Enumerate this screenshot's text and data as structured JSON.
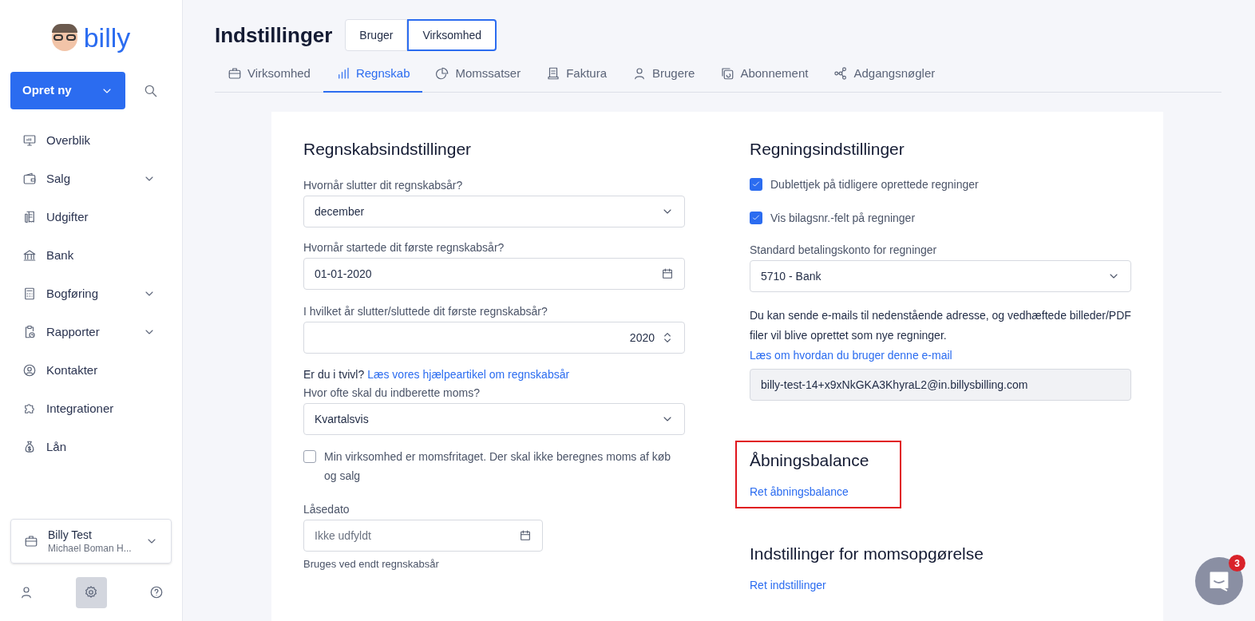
{
  "sidebar": {
    "logo_text": "billy",
    "create_button": "Opret ny",
    "items": [
      {
        "label": "Overblik",
        "expandable": false
      },
      {
        "label": "Salg",
        "expandable": true
      },
      {
        "label": "Udgifter",
        "expandable": false
      },
      {
        "label": "Bank",
        "expandable": false
      },
      {
        "label": "Bogføring",
        "expandable": true
      },
      {
        "label": "Rapporter",
        "expandable": true
      },
      {
        "label": "Kontakter",
        "expandable": false
      },
      {
        "label": "Integrationer",
        "expandable": false
      },
      {
        "label": "Lån",
        "expandable": false
      }
    ],
    "account": {
      "name": "Billy Test",
      "owner": "Michael Boman H..."
    },
    "bottom_icons": [
      {
        "selected": false
      },
      {
        "selected": true
      },
      {
        "selected": false
      }
    ]
  },
  "header": {
    "title": "Indstillinger",
    "scope_tabs": [
      {
        "label": "Bruger",
        "selected": false
      },
      {
        "label": "Virksomhed",
        "selected": true
      }
    ]
  },
  "tabs": [
    {
      "label": "Virksomhed",
      "selected": false
    },
    {
      "label": "Regnskab",
      "selected": true
    },
    {
      "label": "Momssatser",
      "selected": false
    },
    {
      "label": "Faktura",
      "selected": false
    },
    {
      "label": "Brugere",
      "selected": false
    },
    {
      "label": "Abonnement",
      "selected": false
    },
    {
      "label": "Adgangsnøgler",
      "selected": false
    }
  ],
  "left": {
    "heading": "Regnskabsindstillinger",
    "rows": [
      {
        "kind": "select",
        "label": "Hvornår slutter dit regnskabsår?",
        "value": "december"
      },
      {
        "kind": "date",
        "label": "Hvornår startede dit første regnskabsår?",
        "value": "01-01-2020"
      },
      {
        "kind": "number",
        "label": "I hvilket år slutter/sluttede dit første regnskabsår?",
        "value": "2020"
      },
      {
        "kind": "help",
        "text": "Er du i tvivl?",
        "link": "Læs vores hjælpeartikel om regnskabsår"
      },
      {
        "kind": "select",
        "label": "Hvor ofte skal du indberette moms?",
        "value": "Kvartalsvis"
      },
      {
        "kind": "checkbox",
        "label": "Min virksomhed er momsfritaget. Der skal ikke beregnes moms af køb og salg",
        "checked": false
      },
      {
        "kind": "date_short",
        "label": "Låsedato",
        "placeholder": "Ikke udfyldt",
        "hint": "Bruges ved endt regnskabsår"
      }
    ]
  },
  "right": {
    "heading": "Regningsindstillinger",
    "rows": [
      {
        "kind": "checkbox",
        "label": "Dublettjek på tidligere oprettede regninger",
        "checked": true
      },
      {
        "kind": "checkbox",
        "label": "Vis bilagsnr.-felt på regninger",
        "checked": true
      },
      {
        "kind": "select",
        "label": "Standard betalingskonto for regninger",
        "value": "5710 - Bank"
      },
      {
        "kind": "paragraph",
        "text": "Du kan sende e-mails til nedenstående adresse, og vedhæftede billeder/PDF filer vil blive oprettet som nye regninger.",
        "link": "Læs om hvordan du bruger denne e-mail"
      },
      {
        "kind": "readonly",
        "value": "billy-test-14+x9xNkGKA3KhyraL2@in.billysbilling.com"
      }
    ],
    "sections": [
      {
        "heading": "Åbningsbalance",
        "link": "Ret åbningsbalance",
        "highlighted": true
      },
      {
        "heading": "Indstillinger for momsopgørelse",
        "link": "Ret indstillinger",
        "highlighted": false
      }
    ]
  },
  "chat": {
    "badge": "3"
  }
}
